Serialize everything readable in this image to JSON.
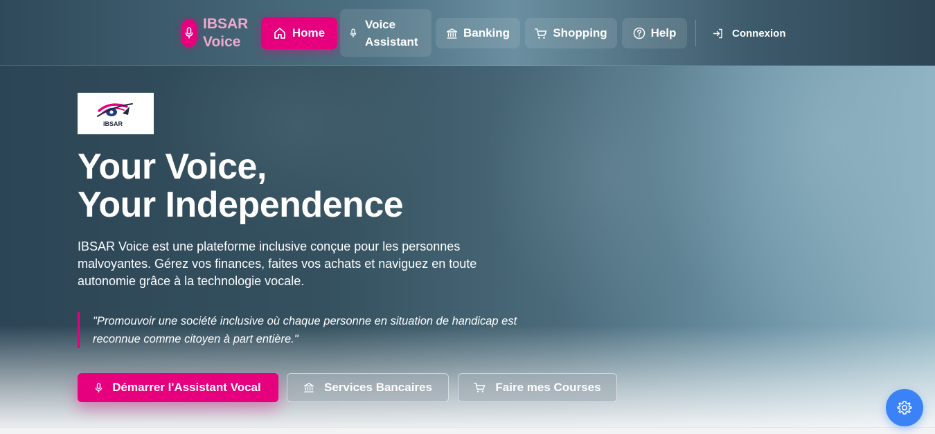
{
  "brand": {
    "line1": "IBSAR",
    "line2": "Voice",
    "accent": "#e6007e"
  },
  "nav": {
    "home": "Home",
    "voice_line1": "Voice",
    "voice_line2": "Assistant",
    "banking": "Banking",
    "shopping": "Shopping",
    "help": "Help",
    "login": "Connexion"
  },
  "hero": {
    "logo_text": "IBSAR",
    "title_line1": "Your Voice,",
    "title_line2": "Your Independence",
    "description": "IBSAR Voice est une plateforme inclusive conçue pour les personnes malvoyantes. Gérez vos finances, faites vos achats et naviguez en toute autonomie grâce à la technologie vocale.",
    "quote": "\"Promouvoir une société inclusive où chaque personne en situation de handicap est reconnue comme citoyen à part entière.\""
  },
  "actions": {
    "voice": "Démarrer l'Assistant Vocal",
    "banking": "Services Bancaires",
    "shopping": "Faire mes Courses"
  },
  "icons": {
    "brand": "microphone-icon",
    "home": "home-icon",
    "voice": "microphone-icon",
    "banking": "bank-icon",
    "shopping": "cart-icon",
    "help": "help-circle-icon",
    "login": "login-icon",
    "settings": "gear-icon"
  },
  "colors": {
    "primary": "#e6007e",
    "settings": "#3b82f6"
  }
}
